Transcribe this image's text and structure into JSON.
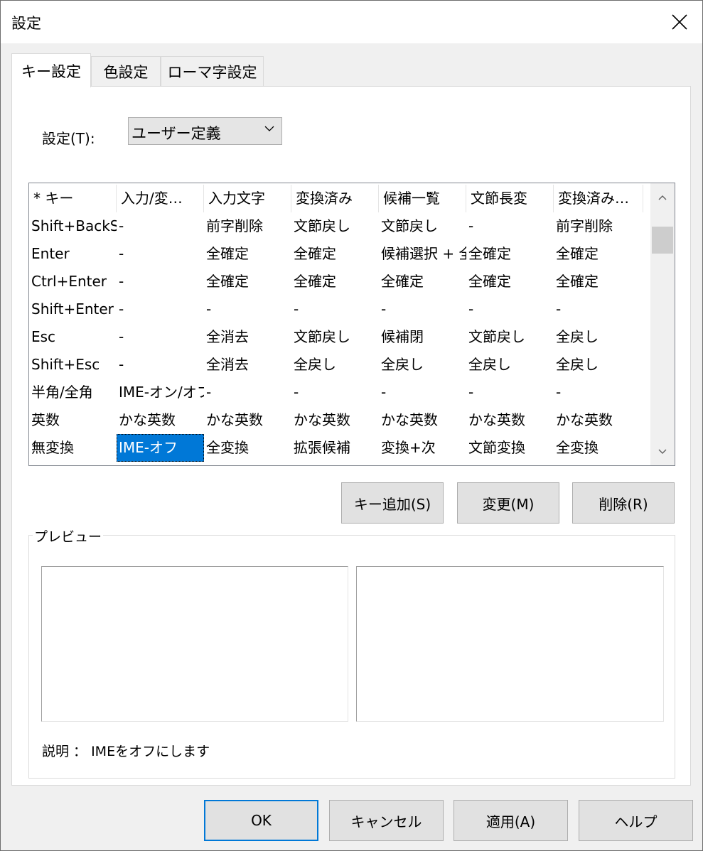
{
  "window": {
    "title": "設定"
  },
  "tabs": [
    "キー設定",
    "色設定",
    "ローマ字設定"
  ],
  "setting": {
    "label": "設定(T):",
    "value": "ユーザー定義"
  },
  "grid": {
    "columns": [
      "* キー",
      "入力/変…",
      "入力文字",
      "変換済み",
      "候補一覧",
      "文節長変",
      "変換済み…"
    ],
    "rows": [
      [
        "Shift+BackSpace",
        "-",
        "前字削除",
        "文節戻し",
        "文節戻し",
        "-",
        "前字削除"
      ],
      [
        "Enter",
        "-",
        "全確定",
        "全確定",
        "候補選択 + 全確定",
        "全確定",
        "全確定"
      ],
      [
        "Ctrl+Enter",
        "-",
        "全確定",
        "全確定",
        "全確定",
        "全確定",
        "全確定"
      ],
      [
        "Shift+Enter",
        "-",
        "-",
        "-",
        "-",
        "-",
        "-"
      ],
      [
        "Esc",
        "-",
        "全消去",
        "文節戻し",
        "候補閉",
        "文節戻し",
        "全戻し"
      ],
      [
        "Shift+Esc",
        "-",
        "全消去",
        "全戻し",
        "全戻し",
        "全戻し",
        "全戻し"
      ],
      [
        "半角/全角",
        "IME-オン/オフ",
        "-",
        "-",
        "-",
        "-",
        "-"
      ],
      [
        "英数",
        "かな英数",
        "かな英数",
        "かな英数",
        "かな英数",
        "かな英数",
        "かな英数"
      ],
      [
        "無変換",
        "IME-オフ",
        "全変換",
        "拡張候補",
        "変換+次",
        "文節変換",
        "全変換"
      ]
    ],
    "selected_row": 8,
    "selected_col": 1
  },
  "actions": {
    "add": "キー追加(S)",
    "change": "変更(M)",
    "delete": "削除(R)"
  },
  "preview": {
    "title": "プレビュー",
    "description": "説明 ： IMEをオフにします"
  },
  "footer": {
    "ok": "OK",
    "cancel": "キャンセル",
    "apply": "適用(A)",
    "help": "ヘルプ"
  },
  "colors": {
    "selection": "#0078d7",
    "default_border": "#0078d7"
  }
}
